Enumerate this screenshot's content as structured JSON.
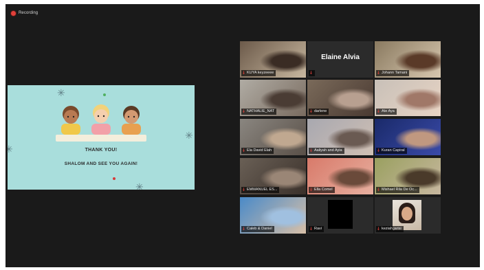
{
  "recording": {
    "label": "Recording",
    "dot_color": "#e0403a"
  },
  "slide": {
    "title": "THANK YOU!",
    "subtitle": "SHALOM AND SEE YOU AGAIN!",
    "background": "#a9dedc"
  },
  "participants": [
    {
      "name": "KUYA keyzeeee",
      "muted": true,
      "video": [
        "#6c5a4a",
        "#c8b8a0",
        "#3a2c24"
      ]
    },
    {
      "name": "Elaine Alvia",
      "muted": false,
      "video_off": true
    },
    {
      "name": "Johann Tamani",
      "muted": true,
      "video": [
        "#8a7a60",
        "#d8c8b0",
        "#5a3a28"
      ]
    },
    {
      "name": "NATHALIE_NAT",
      "muted": true,
      "video": [
        "#b0aca4",
        "#7a6c60",
        "#4a3c34"
      ]
    },
    {
      "name": "darlene",
      "muted": false,
      "video": [
        "#7a6a5a",
        "#4a3a32",
        "#b8a090"
      ]
    },
    {
      "name": "Ate Aya",
      "muted": true,
      "video": [
        "#c8c0b8",
        "#e8d4c4",
        "#a07868"
      ]
    },
    {
      "name": "Ela David Elah",
      "muted": true,
      "video": [
        "#8a8680",
        "#5a5048",
        "#c0a890"
      ]
    },
    {
      "name": "Aaliyah and Ayia",
      "muted": true,
      "video": [
        "#a8a8b0",
        "#d0c0b4",
        "#6a5a52"
      ]
    },
    {
      "name": "Kuran Capiral",
      "muted": true,
      "video": [
        "#1a2a6a",
        "#3a4aa8",
        "#c09880"
      ]
    },
    {
      "name": "EMMANUEL ES...",
      "muted": true,
      "video": [
        "#6a6056",
        "#3a302a",
        "#9a8676"
      ]
    },
    {
      "name": "Ella Comel",
      "muted": false,
      "active": true,
      "video": [
        "#d87a6a",
        "#e8b0a0",
        "#6a4a3a"
      ]
    },
    {
      "name": "Mishael Rila De Oc...",
      "muted": true,
      "video": [
        "#9aa060",
        "#c8b8a0",
        "#4a3a2a"
      ]
    },
    {
      "name": "Caleb & Daniel",
      "muted": true,
      "video": [
        "#4a8ac8",
        "#d8c0a8",
        "#a0c0e0"
      ]
    },
    {
      "name": "Ravi",
      "muted": true,
      "blackbox": true
    },
    {
      "name": "keziah jarisi",
      "muted": true,
      "portrait": true
    }
  ]
}
